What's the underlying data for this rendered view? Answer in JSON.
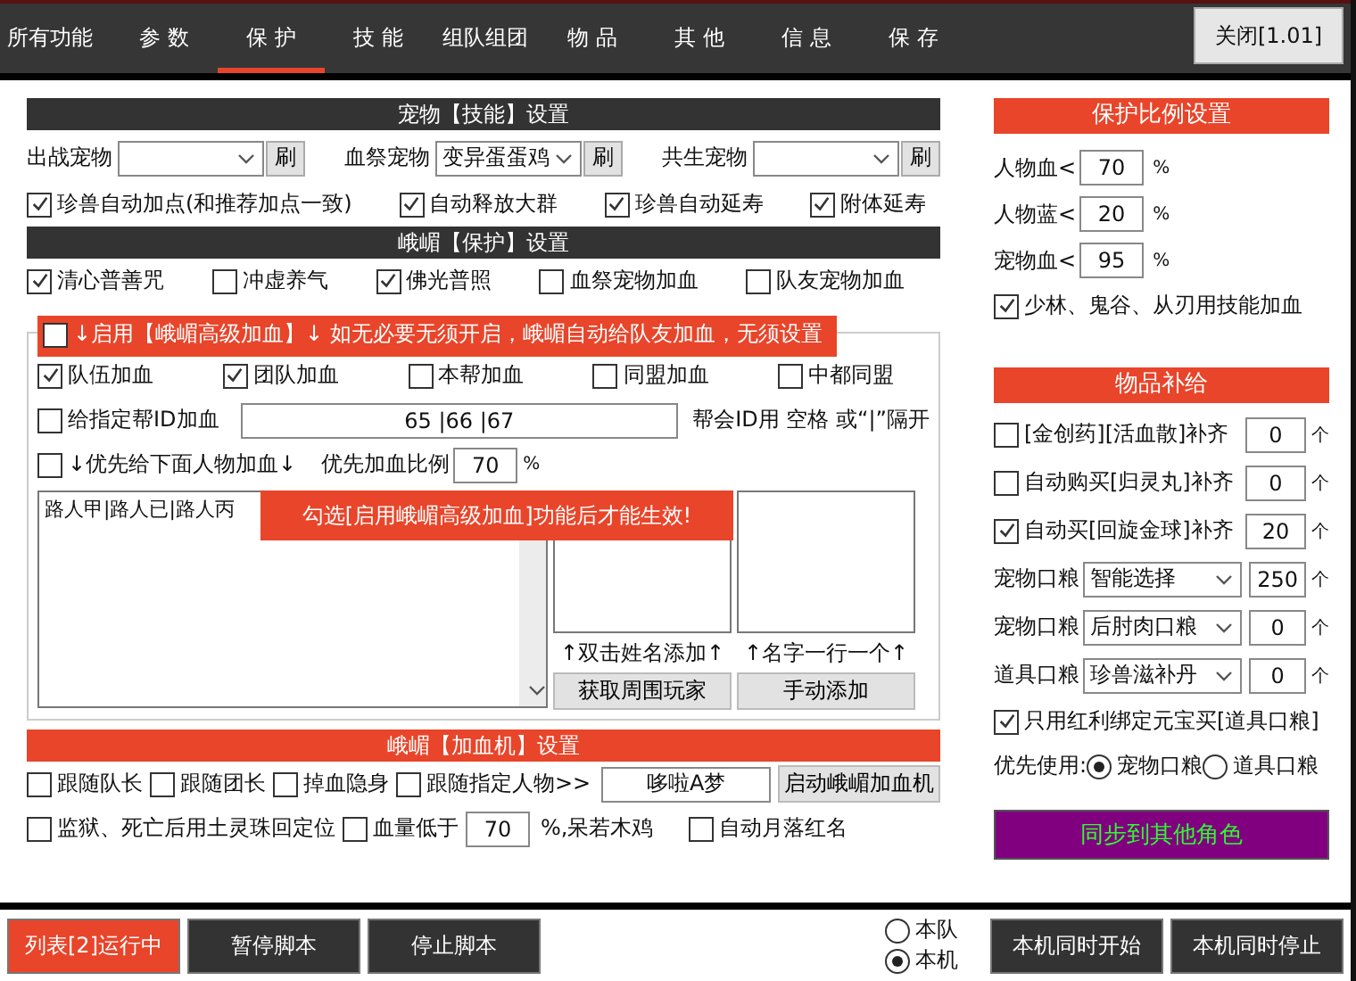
{
  "tabs": [
    {
      "label": "所有功能",
      "selected": false
    },
    {
      "label": "参 数",
      "selected": false
    },
    {
      "label": "保 护",
      "selected": true
    },
    {
      "label": "技 能",
      "selected": false
    },
    {
      "label": "组队组团",
      "selected": false
    },
    {
      "label": "物 品",
      "selected": false
    },
    {
      "label": "其 他",
      "selected": false
    },
    {
      "label": "信 息",
      "selected": false
    },
    {
      "label": "保 存",
      "selected": false
    }
  ],
  "close_button": "关闭[1.01]",
  "pet": {
    "title": "宠物【技能】设置",
    "selects": [
      {
        "label": "出战宠物",
        "refresh": "刷"
      },
      {
        "label": "血祭宠物",
        "value": "变异蛋蛋鸡",
        "refresh": "刷"
      },
      {
        "label": "共生宠物",
        "refresh": "刷"
      }
    ],
    "checks": [
      {
        "label": "珍兽自动加点(和推荐加点一致)",
        "checked": true
      },
      {
        "label": "自动释放大群",
        "checked": true
      },
      {
        "label": "珍兽自动延寿",
        "checked": true
      },
      {
        "label": "附体延寿",
        "checked": true
      }
    ]
  },
  "protect": {
    "title": "峨嵋【保护】设置",
    "checks": [
      {
        "label": "清心普善咒",
        "checked": true
      },
      {
        "label": "冲虚养气",
        "checked": false
      },
      {
        "label": "佛光普照",
        "checked": true
      },
      {
        "label": "血祭宠物加血",
        "checked": false
      },
      {
        "label": "队友宠物加血",
        "checked": false
      }
    ]
  },
  "advanced": {
    "enable": {
      "label": "↓启用【峨嵋高级加血】↓ 如无必要无须开启，峨嵋自动给队友加血，无须设置",
      "checked": false
    },
    "checks": [
      {
        "label": "队伍加血",
        "checked": true
      },
      {
        "label": "团队加血",
        "checked": true
      },
      {
        "label": "本帮加血",
        "checked": false
      },
      {
        "label": "同盟加血",
        "checked": false
      },
      {
        "label": "中都同盟",
        "checked": false
      }
    ],
    "guild": {
      "label": "给指定帮ID加血",
      "checked": false,
      "value": "65 |66 |67",
      "hint": "帮会ID用 空格 或“|”隔开"
    },
    "priority": {
      "label": "↓优先给下面人物加血↓",
      "checked": false,
      "ratio_label": "优先加血比例",
      "ratio": "70",
      "unit": "%"
    },
    "list_text": "路人甲|路人已|路人丙",
    "toast": "勾选[启用峨嵋高级加血]功能后才能生效!",
    "nearby_caption": "↑双击姓名添加↑",
    "manual_caption": "↑名字一行一个↑",
    "buttons": [
      "获取周围玩家",
      "手动添加"
    ]
  },
  "heal_machine": {
    "title": "峨嵋【加血机】设置",
    "follow": [
      {
        "label": "跟随队长",
        "checked": false
      },
      {
        "label": "跟随团长",
        "checked": false
      },
      {
        "label": "掉血隐身",
        "checked": false
      },
      {
        "label": "跟随指定人物>>",
        "checked": false
      }
    ],
    "target": "哆啦A梦",
    "start_button": "启动峨嵋加血机",
    "relocate": {
      "label": "监狱、死亡后用土灵珠回定位",
      "checked": false
    },
    "low_hp": {
      "label": "血量低于",
      "checked": false,
      "value": "70",
      "suffix": "%,呆若木鸡"
    },
    "red_name": {
      "label": "自动月落红名",
      "checked": false
    }
  },
  "ratio": {
    "title": "保护比例设置",
    "fields": [
      {
        "label": "人物血<",
        "value": "70",
        "unit": "%"
      },
      {
        "label": "人物蓝<",
        "value": "20",
        "unit": "%"
      },
      {
        "label": "宠物血<",
        "value": "95",
        "unit": "%"
      }
    ],
    "skill_heal": {
      "label": "少林、鬼谷、从刃用技能加血",
      "checked": true
    }
  },
  "supply": {
    "title": "物品补给",
    "rows": [
      {
        "kind": "check",
        "label": "[金创药][活血散]补齐",
        "checked": false,
        "value": "0",
        "unit": "个"
      },
      {
        "kind": "check",
        "label": "自动购买[归灵丸]补齐",
        "checked": false,
        "value": "0",
        "unit": "个"
      },
      {
        "kind": "check",
        "label": "自动买[回旋金球]补齐",
        "checked": true,
        "value": "20",
        "unit": "个"
      },
      {
        "kind": "select",
        "label": "宠物口粮",
        "choice": "智能选择",
        "value": "250",
        "unit": "个"
      },
      {
        "kind": "select",
        "label": "宠物口粮",
        "choice": "后肘肉口粮",
        "value": "0",
        "unit": "个"
      },
      {
        "kind": "select",
        "label": "道具口粮",
        "choice": "珍兽滋补丹",
        "value": "0",
        "unit": "个"
      }
    ],
    "bonus_only": {
      "label": "只用红利绑定元宝买[道具口粮]",
      "checked": true
    },
    "prefer_label": "优先使用:",
    "prefer": [
      {
        "label": "宠物口粮",
        "selected": true
      },
      {
        "label": "道具口粮",
        "selected": false
      }
    ],
    "sync_button": "同步到其他角色"
  },
  "footer": {
    "buttons": [
      {
        "label": "列表[2]运行中",
        "kind": "running"
      },
      {
        "label": "暂停脚本",
        "kind": "normal"
      },
      {
        "label": "停止脚本",
        "kind": "normal"
      }
    ],
    "scope": [
      {
        "label": "本队",
        "selected": false
      },
      {
        "label": "本机",
        "selected": true
      }
    ],
    "machine_buttons": [
      "本机同时开始",
      "本机同时停止"
    ]
  }
}
